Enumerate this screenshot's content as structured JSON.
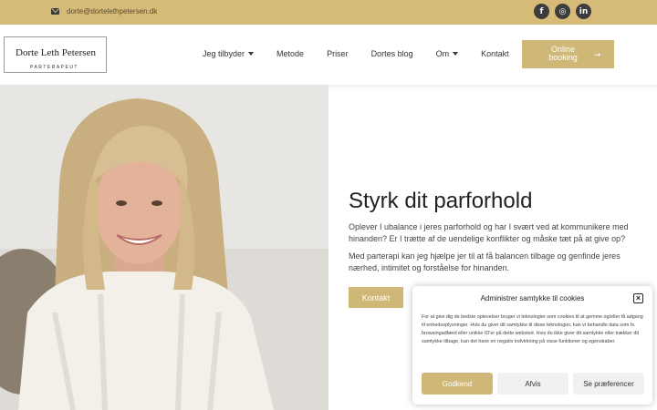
{
  "topbar": {
    "email": "dorte@dortelethpetersen.dk",
    "socials": [
      {
        "icon": "facebook-icon",
        "glyph": "f"
      },
      {
        "icon": "instagram-icon",
        "glyph": "◎"
      },
      {
        "icon": "linkedin-icon",
        "glyph": "in"
      }
    ]
  },
  "logo": {
    "name": "Dorte Leth Petersen",
    "subtitle": "PARTERAPEUT"
  },
  "nav": {
    "items": [
      {
        "label": "Jeg tilbyder",
        "dropdown": true
      },
      {
        "label": "Metode",
        "dropdown": false
      },
      {
        "label": "Priser",
        "dropdown": false
      },
      {
        "label": "Dortes blog",
        "dropdown": false
      },
      {
        "label": "Om",
        "dropdown": true
      },
      {
        "label": "Kontakt",
        "dropdown": false
      }
    ],
    "booking_label": "Online booking",
    "booking_arrow": "➞"
  },
  "hero": {
    "title": "Styrk dit parforhold",
    "para1": "Oplever I ubalance i jeres parforhold og har I svært ved at kommunikere med hinanden? Er I trætte af de uendelige konflikter og måske tæt på at give op?",
    "para2": "Med parterapi kan jeg hjælpe jer til at få balancen tilbage og genfinde jeres nærhed, intimitet og forståelse for hinanden.",
    "button": "Kontakt"
  },
  "cookie": {
    "title": "Administrer samtykke til cookies",
    "close": "×",
    "text": "For at give dig de bedste oplevelser bruger vi teknologier som cookies til at gemme og/eller få adgang til enhedsoplysninger. Hvis du giver dit samtykke til disse teknologier, kan vi behandle data som fx. browsingadfærd eller unikke ID'er på dette websted. Hvis du ikke giver dit samtykke eller trækker dit samtykke tilbage, kan det have en negativ indvirkning på visse funktioner og egenskaber.",
    "accept": "Godkend",
    "deny": "Afvis",
    "prefs": "Se præferencer"
  },
  "colors": {
    "gold": "#cfb777",
    "topbar": "#d6bb78"
  }
}
